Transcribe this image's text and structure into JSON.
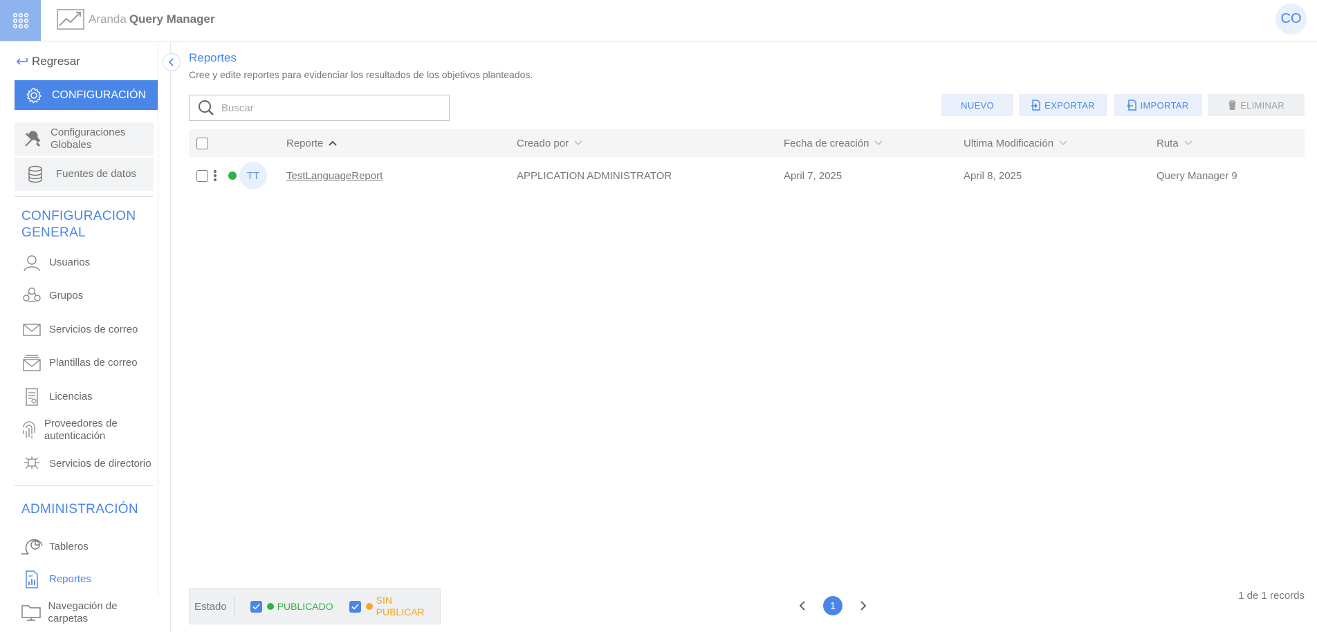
{
  "app": {
    "brand_light": "Aranda",
    "brand_bold": "Query Manager",
    "user_initials": "CO"
  },
  "sidebar": {
    "back_label": "Regresar",
    "config_label": "CONFIGURACIÓN",
    "sub_items": [
      {
        "label": "Configuraciones Globales",
        "icon": "tools-icon"
      },
      {
        "label": "Fuentes de datos",
        "icon": "database-icon"
      }
    ],
    "section_general": "CONFIGURACION GENERAL",
    "general_items": [
      {
        "label": "Usuarios",
        "icon": "user-icon"
      },
      {
        "label": "Grupos",
        "icon": "group-icon"
      },
      {
        "label": "Servicios de correo",
        "icon": "mail-icon"
      },
      {
        "label": "Plantillas de correo",
        "icon": "mail-template-icon"
      },
      {
        "label": "Licencias",
        "icon": "license-icon"
      },
      {
        "label": "Proveedores de autenticación",
        "icon": "fingerprint-icon"
      },
      {
        "label": "Servicios de directorio",
        "icon": "directory-icon"
      }
    ],
    "section_admin": "ADMINISTRACIÓN",
    "admin_items": [
      {
        "label": "Tableros",
        "icon": "dashboard-icon"
      },
      {
        "label": "Reportes",
        "icon": "report-icon",
        "active": true
      },
      {
        "label": "Navegación de carpetas",
        "icon": "folder-icon"
      }
    ]
  },
  "page": {
    "title": "Reportes",
    "subtitle": "Cree y edite reportes para evidenciar los resultados de los objetivos planteados.",
    "search_placeholder": "Buscar"
  },
  "toolbar": {
    "new_label": "NUEVO",
    "export_label": "EXPORTAR",
    "import_label": "IMPORTAR",
    "delete_label": "ELIMINAR"
  },
  "table": {
    "columns": [
      "Reporte",
      "Creado por",
      "Fecha de creación",
      "Ultima Modificación",
      "Ruta"
    ],
    "rows": [
      {
        "avatar": "TT",
        "status": "published",
        "name": "TestLanguageReport",
        "created_by": "APPLICATION ADMINISTRATOR",
        "created": "April 7, 2025",
        "modified": "April 8, 2025",
        "path": "Query Manager 9"
      }
    ]
  },
  "footer": {
    "estado_label": "Estado",
    "published_label": "PUBLICADO",
    "unpublished_label": "SIN PUBLICAR",
    "current_page": "1",
    "records_text": "1 de 1 records"
  },
  "colors": {
    "accent": "#4a86e8",
    "published": "#2fb344",
    "unpublished": "#f5a623"
  }
}
